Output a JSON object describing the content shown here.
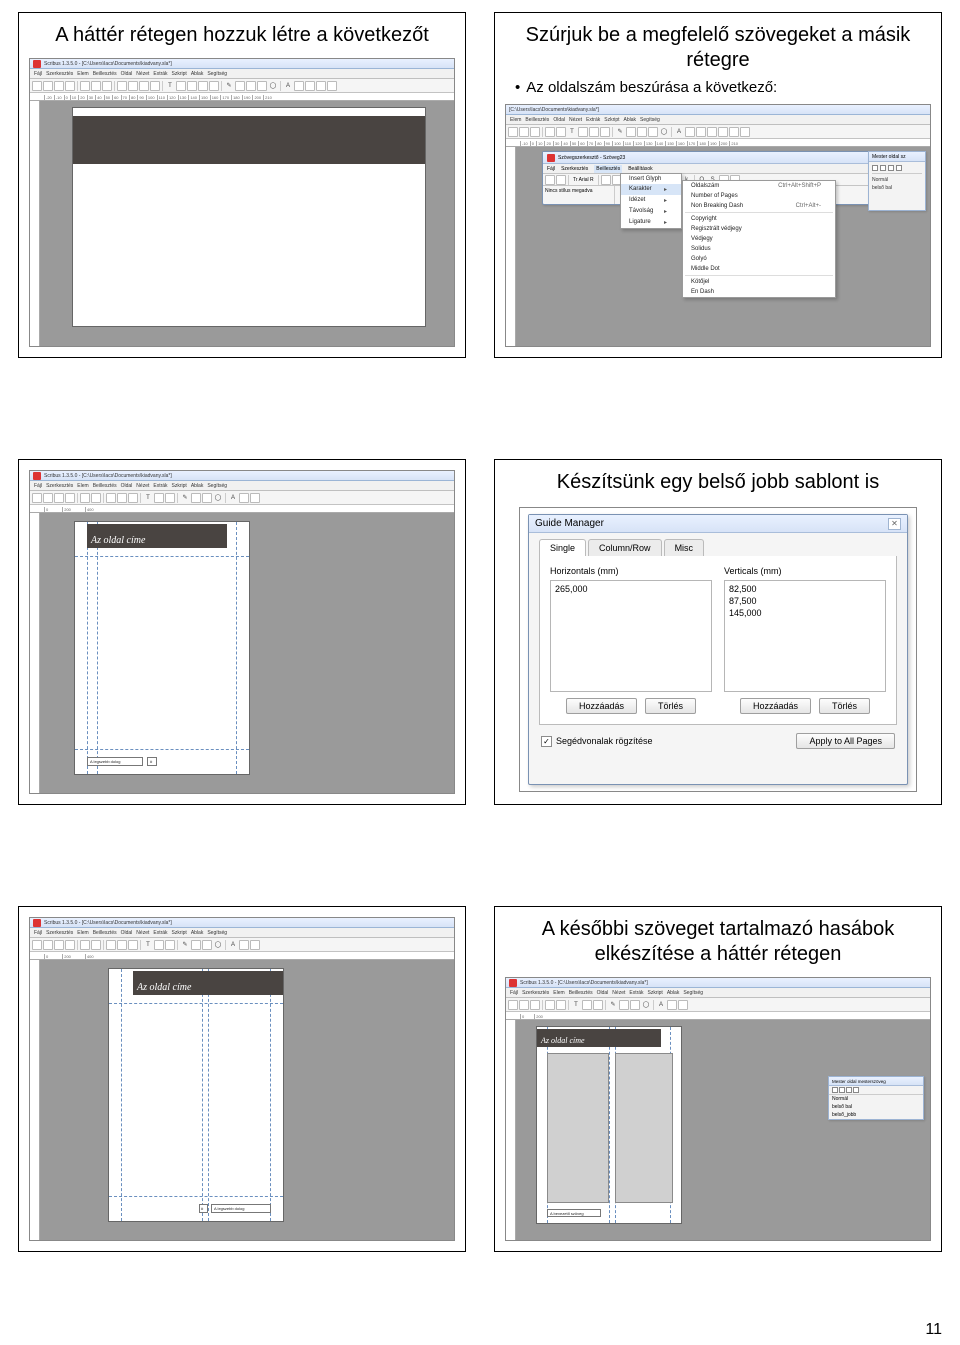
{
  "page_number": "11",
  "pair1": {
    "left": {
      "title": "A háttér rétegen hozzuk létre a következőt",
      "titlebar": "Scribus 1.3.5.0 - [C:\\Users\\Iacs\\Documents\\kiadvany.sla*]",
      "menus": [
        "Fájl",
        "Szerkesztés",
        "Elem",
        "Beillesztés",
        "Oldal",
        "Nézet",
        "Extrák",
        "Szkript",
        "Ablak",
        "Segítség"
      ]
    },
    "right": {
      "title": "Szúrjuk be a megfelelő szövegeket a másik rétegre",
      "bullet": "Az oldalszám beszúrása a következő:",
      "titlebar": "[C:\\Users\\Iacs\\Documents\\kiadvany.sla*]",
      "menus": [
        "...",
        "Elem",
        "Beillesztés",
        "Oldal",
        "Nézet",
        "Extrák",
        "Szkript",
        "Ablak",
        "Segítség"
      ],
      "story_editor": {
        "title": "Szövegszerkesztő - Szöveg23",
        "menus": [
          "Fájl",
          "Szerkesztés",
          "Beillesztés",
          "Beállítások"
        ],
        "left_field": "Nincs stílus megadva"
      },
      "ctx_menu1": [
        "Insert Glyph",
        "Karakter",
        "Idézet",
        "Távolság",
        "Ligature"
      ],
      "ctx_menu2": [
        {
          "label": "Oldalszám",
          "shortcut": "Ctrl+Alt+Shift+P"
        },
        {
          "label": "Number of Pages",
          "shortcut": ""
        },
        {
          "label": "Non Breaking Dash",
          "shortcut": "Ctrl+Alt+-"
        },
        {
          "label": "Copyright",
          "shortcut": ""
        },
        {
          "label": "Regisztrált védjegy",
          "shortcut": ""
        },
        {
          "label": "Védjegy",
          "shortcut": ""
        },
        {
          "label": "Solidus",
          "shortcut": ""
        },
        {
          "label": "Golyó",
          "shortcut": ""
        },
        {
          "label": "Middle Dot",
          "shortcut": ""
        },
        {
          "label": "Kötőjel",
          "shortcut": ""
        },
        {
          "label": "En Dash",
          "shortcut": ""
        }
      ],
      "side_panel": {
        "title": "Mester oldal sz",
        "rows": [
          "Normál",
          "belső bal"
        ]
      }
    }
  },
  "pair2": {
    "left": {
      "titlebar": "Scribus 1.3.5.0 - [C:\\Users\\Iacs\\Documents\\kiadvany.sla*]",
      "menus": [
        "Fájl",
        "Szerkesztés",
        "Elem",
        "Beillesztés",
        "Oldal",
        "Nézet",
        "Extrák",
        "Szkript",
        "Ablak",
        "Segítség"
      ],
      "page_header": "Az oldal címe",
      "small_caption": "A legszebb dolog"
    },
    "right": {
      "title": "Készítsünk egy belső jobb sablont is",
      "dialog": {
        "title": "Guide Manager",
        "tabs": [
          "Single",
          "Column/Row",
          "Misc"
        ],
        "h_label": "Horizontals (mm)",
        "v_label": "Verticals (mm)",
        "h_values": [
          "265,000"
        ],
        "v_values": [
          "82,500",
          "87,500",
          "145,000"
        ],
        "btn_add": "Hozzáadás",
        "btn_del": "Törlés",
        "lock_guides": "Segédvonalak rögzítése",
        "apply_all": "Apply to All Pages"
      }
    }
  },
  "pair3": {
    "left": {
      "titlebar": "Scribus 1.3.5.0 - [C:\\Users\\Iacs\\Documents\\kiadvany.sla*]",
      "menus": [
        "Fájl",
        "Szerkesztés",
        "Elem",
        "Beillesztés",
        "Oldal",
        "Nézet",
        "Extrák",
        "Szkript",
        "Ablak",
        "Segítség"
      ],
      "page_header": "Az oldal címe",
      "small_caption": "A legszebb dolog"
    },
    "right": {
      "title": "A későbbi szöveget tartalmazó hasábok elkészítése a háttér rétegen",
      "titlebar": "Scribus 1.3.5.0 - [C:\\Users\\Iacs\\Documents\\kiadvany.sla*]",
      "menus": [
        "Fájl",
        "Szerkesztés",
        "Elem",
        "Beillesztés",
        "Oldal",
        "Nézet",
        "Extrák",
        "Szkript",
        "Ablak",
        "Segítség"
      ],
      "page_header": "Az oldal címe",
      "small_caption": "A bevezető szöveg",
      "layers": {
        "title": "Mester oldal mesterszöveg",
        "rows": [
          "Normál",
          "belső bal",
          "belső_jobb"
        ]
      }
    }
  }
}
